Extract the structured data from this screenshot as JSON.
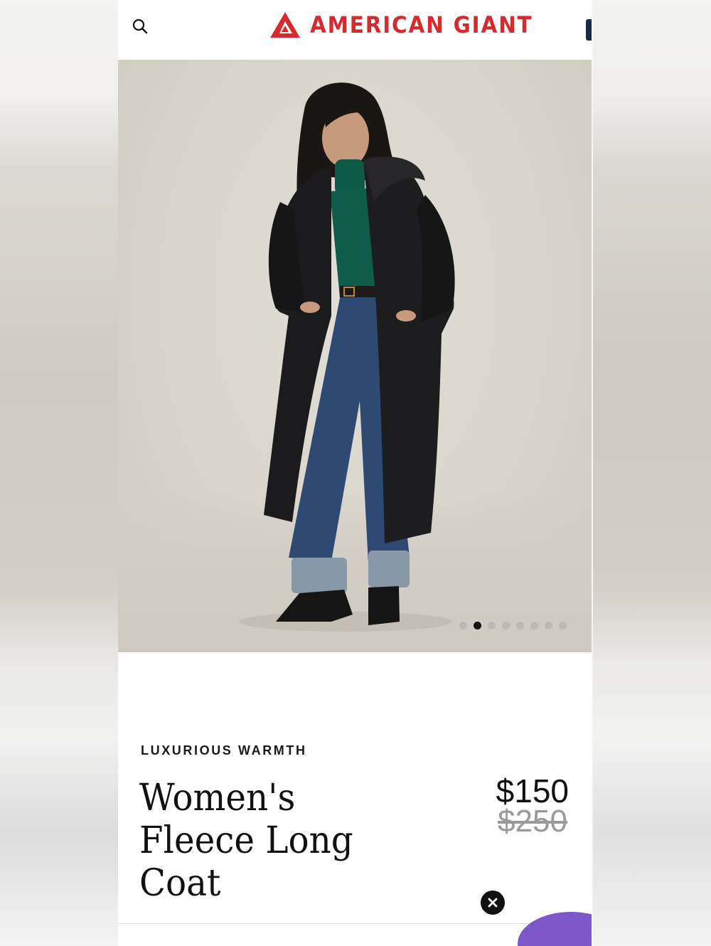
{
  "header": {
    "brand": "AMERICAN GIANT",
    "brand_color": "#d52b2f",
    "search_icon": "search-icon"
  },
  "gallery": {
    "total_images": 8,
    "active_index": 1
  },
  "product": {
    "eyebrow": "LUXURIOUS WARMTH",
    "title": "Women's Fleece Long Coat",
    "price": "$150",
    "original_price": "$250"
  },
  "overlay": {
    "close_icon": "close-icon",
    "chat_color": "#7b57c9"
  }
}
